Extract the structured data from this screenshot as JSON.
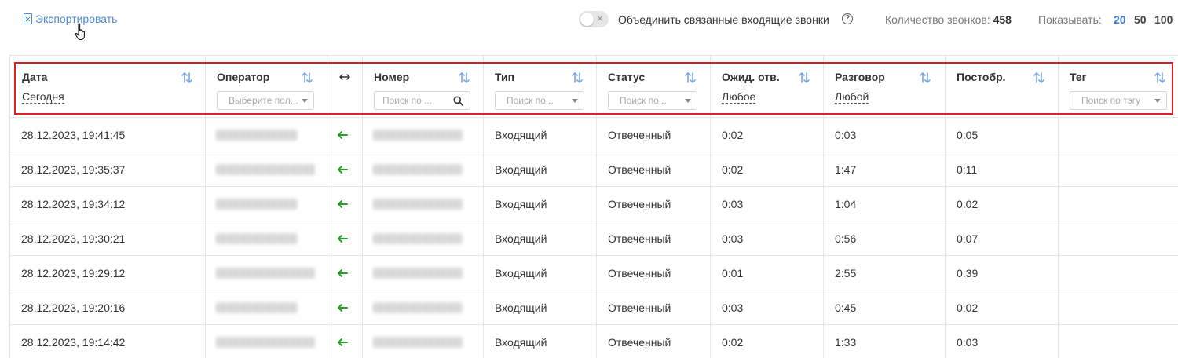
{
  "toolbar": {
    "export_label": "Экспортировать",
    "merge_label": "Объединить связанные входящие звонки",
    "calls_count_label": "Количество звонков:",
    "calls_count_value": "458",
    "show_label": "Показывать:",
    "page_sizes": [
      "20",
      "50",
      "100"
    ],
    "selected_page_size": "20",
    "merge_enabled": false
  },
  "table": {
    "columns": {
      "date": {
        "title": "Дата",
        "filter": "Сегодня"
      },
      "operator": {
        "title": "Оператор",
        "placeholder": "Выберите пол..."
      },
      "number": {
        "title": "Номер",
        "placeholder": "Поиск по ..."
      },
      "type": {
        "title": "Тип",
        "placeholder": "Поиск по..."
      },
      "status": {
        "title": "Статус",
        "placeholder": "Поиск по..."
      },
      "wait": {
        "title": "Ожид. отв.",
        "filter": "Любое"
      },
      "talk": {
        "title": "Разговор",
        "filter": "Любой"
      },
      "post": {
        "title": "Постобр."
      },
      "tag": {
        "title": "Тег",
        "placeholder": "Поиск по тэгу"
      }
    },
    "rows": [
      {
        "date": "28.12.2023, 19:41:45",
        "type": "Входящий",
        "status": "Отвеченный",
        "wait": "0:02",
        "talk": "0:03",
        "post": "0:05"
      },
      {
        "date": "28.12.2023, 19:35:37",
        "type": "Входящий",
        "status": "Отвеченный",
        "wait": "0:02",
        "talk": "1:47",
        "post": "0:11"
      },
      {
        "date": "28.12.2023, 19:34:12",
        "type": "Входящий",
        "status": "Отвеченный",
        "wait": "0:03",
        "talk": "1:04",
        "post": "0:02"
      },
      {
        "date": "28.12.2023, 19:30:21",
        "type": "Входящий",
        "status": "Отвеченный",
        "wait": "0:03",
        "talk": "0:56",
        "post": "0:07"
      },
      {
        "date": "28.12.2023, 19:29:12",
        "type": "Входящий",
        "status": "Отвеченный",
        "wait": "0:01",
        "talk": "2:55",
        "post": "0:39"
      },
      {
        "date": "28.12.2023, 19:20:16",
        "type": "Входящий",
        "status": "Отвеченный",
        "wait": "0:03",
        "talk": "0:45",
        "post": "0:02"
      },
      {
        "date": "28.12.2023, 19:14:42",
        "type": "Входящий",
        "status": "Отвеченный",
        "wait": "0:02",
        "talk": "1:33",
        "post": "0:03"
      }
    ]
  },
  "icons": {
    "export": "document-excel-icon",
    "cursor": "hand-pointer-icon",
    "help": "question-circle-icon",
    "sort": "sort-arrows-icon",
    "direction_header": "swap-horizontal-icon",
    "direction_row": "incoming-arrow-icon",
    "search": "search-icon"
  },
  "colors": {
    "accent": "#3a7bd5",
    "sort_icon": "#7aa8e6",
    "incoming_arrow": "#2a9d2a",
    "highlight": "#e02020"
  }
}
